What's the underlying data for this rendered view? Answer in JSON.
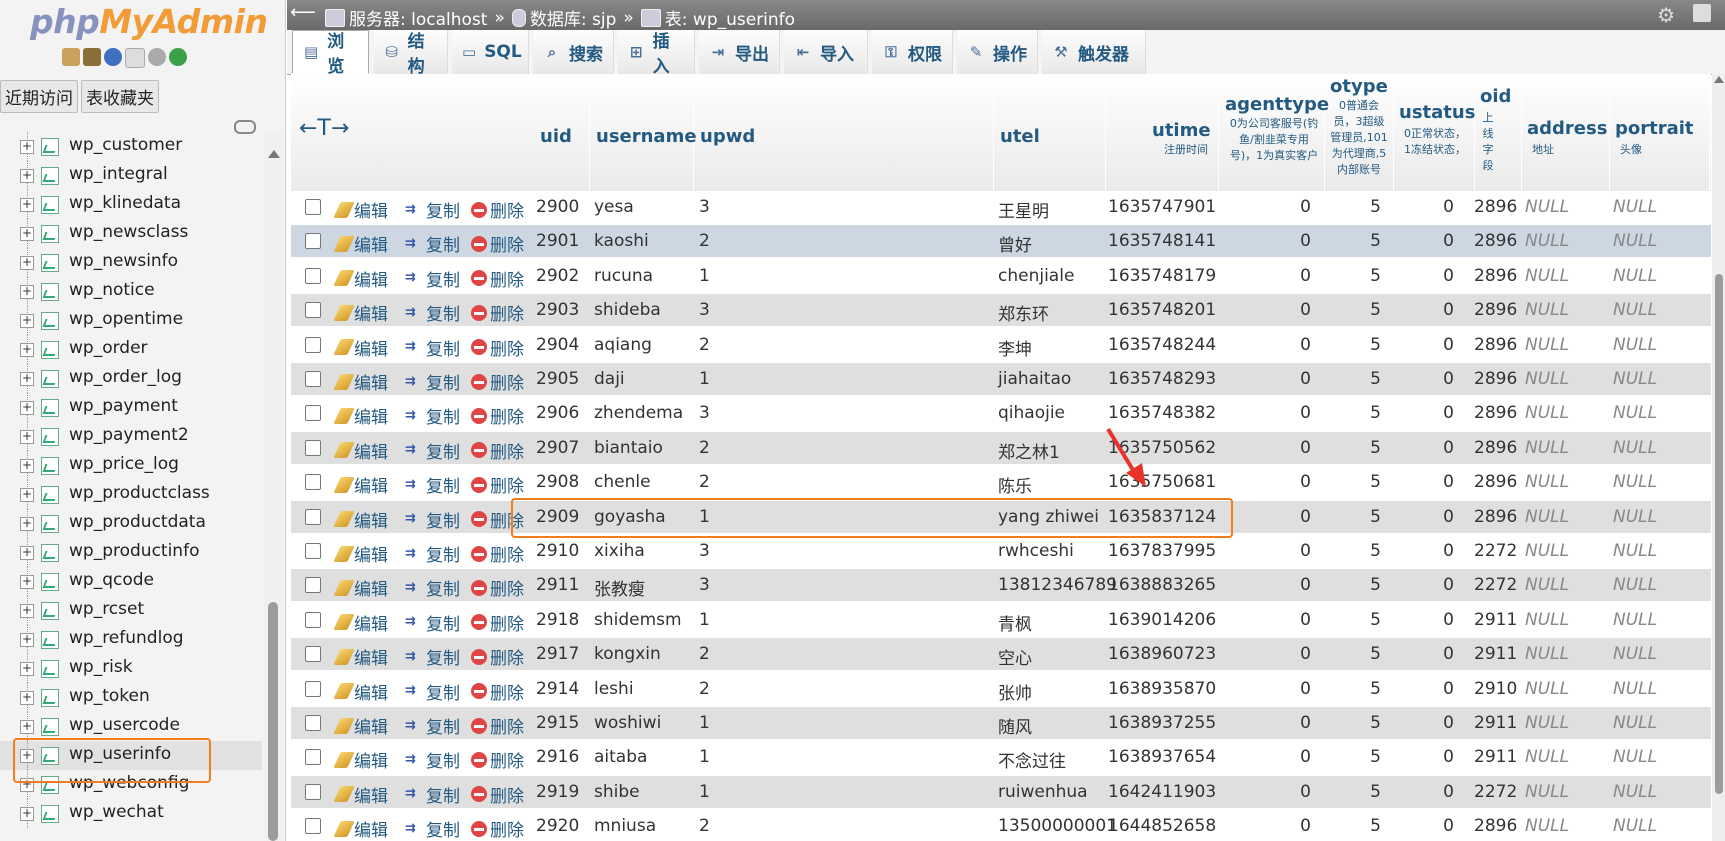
{
  "brand": {
    "php": "php",
    "myadmin": "MyAdmin"
  },
  "nav": {
    "tabs": [
      "近期访问",
      "表收藏夹"
    ],
    "tables": [
      "wp_customer",
      "wp_integral",
      "wp_klinedata",
      "wp_newsclass",
      "wp_newsinfo",
      "wp_notice",
      "wp_opentime",
      "wp_order",
      "wp_order_log",
      "wp_payment",
      "wp_payment2",
      "wp_price_log",
      "wp_productclass",
      "wp_productdata",
      "wp_productinfo",
      "wp_qcode",
      "wp_rcset",
      "wp_refundlog",
      "wp_risk",
      "wp_token",
      "wp_usercode",
      "wp_userinfo",
      "wp_webconfig",
      "wp_wechat"
    ],
    "selected": "wp_userinfo"
  },
  "breadcrumb": {
    "server": "服务器: localhost",
    "database": "数据库: sjp",
    "table": "表: wp_userinfo",
    "separator": "»"
  },
  "tabs": [
    {
      "label": "浏览",
      "icon": "browse-icon"
    },
    {
      "label": "结构",
      "icon": "structure-icon"
    },
    {
      "label": "SQL",
      "icon": "sql-icon"
    },
    {
      "label": "搜索",
      "icon": "search-icon"
    },
    {
      "label": "插入",
      "icon": "insert-icon"
    },
    {
      "label": "导出",
      "icon": "export-icon"
    },
    {
      "label": "导入",
      "icon": "import-icon"
    },
    {
      "label": "权限",
      "icon": "privileges-icon"
    },
    {
      "label": "操作",
      "icon": "operations-icon"
    },
    {
      "label": "触发器",
      "icon": "triggers-icon"
    }
  ],
  "table": {
    "arrows": "←T→",
    "actions": {
      "edit": "编辑",
      "copy": "复制",
      "delete": "删除"
    },
    "columns": [
      {
        "name": "uid",
        "comment": ""
      },
      {
        "name": "username",
        "comment": ""
      },
      {
        "name": "upwd",
        "comment": ""
      },
      {
        "name": "utel",
        "comment": ""
      },
      {
        "name": "utime",
        "comment": "注册时间"
      },
      {
        "name": "agenttype",
        "comment": "0为公司客服号(钓鱼/割韭菜专用号)，1为真实客户"
      },
      {
        "name": "otype",
        "comment": "0普通会员，3超级管理员,101为代理商,5内部账号"
      },
      {
        "name": "ustatus",
        "comment": "0正常状态，1冻结状态，"
      },
      {
        "name": "oid",
        "comment": "上线字段"
      },
      {
        "name": "address",
        "comment": "地址"
      },
      {
        "name": "portrait",
        "comment": "头像"
      }
    ],
    "rows": [
      [
        "2900",
        "yesa",
        "3",
        "王星明",
        "1635747901",
        "0",
        "5",
        "0",
        "2896",
        "NULL",
        "NULL"
      ],
      [
        "2901",
        "kaoshi",
        "2",
        "曾好",
        "1635748141",
        "0",
        "5",
        "0",
        "2896",
        "NULL",
        "NULL"
      ],
      [
        "2902",
        "rucuna",
        "1",
        "chenjiale",
        "1635748179",
        "0",
        "5",
        "0",
        "2896",
        "NULL",
        "NULL"
      ],
      [
        "2903",
        "shideba",
        "3",
        "郑东环",
        "1635748201",
        "0",
        "5",
        "0",
        "2896",
        "NULL",
        "NULL"
      ],
      [
        "2904",
        "aqiang",
        "2",
        "李坤",
        "1635748244",
        "0",
        "5",
        "0",
        "2896",
        "NULL",
        "NULL"
      ],
      [
        "2905",
        "daji",
        "1",
        "jiahaitao",
        "1635748293",
        "0",
        "5",
        "0",
        "2896",
        "NULL",
        "NULL"
      ],
      [
        "2906",
        "zhendema",
        "3",
        "qihaojie",
        "1635748382",
        "0",
        "5",
        "0",
        "2896",
        "NULL",
        "NULL"
      ],
      [
        "2907",
        "biantaio",
        "2",
        "郑之林1",
        "1635750562",
        "0",
        "5",
        "0",
        "2896",
        "NULL",
        "NULL"
      ],
      [
        "2908",
        "chenle",
        "2",
        "陈乐",
        "1635750681",
        "0",
        "5",
        "0",
        "2896",
        "NULL",
        "NULL"
      ],
      [
        "2909",
        "goyasha",
        "1",
        "yang zhiwei",
        "1635837124",
        "0",
        "5",
        "0",
        "2896",
        "NULL",
        "NULL"
      ],
      [
        "2910",
        "xixiha",
        "3",
        "rwhceshi",
        "1637837995",
        "0",
        "5",
        "0",
        "2272",
        "NULL",
        "NULL"
      ],
      [
        "2911",
        "张教瘦",
        "3",
        "13812346789",
        "1638883265",
        "0",
        "5",
        "0",
        "2272",
        "NULL",
        "NULL"
      ],
      [
        "2918",
        "shidemsm",
        "1",
        "青枫",
        "1639014206",
        "0",
        "5",
        "0",
        "2911",
        "NULL",
        "NULL"
      ],
      [
        "2917",
        "kongxin",
        "2",
        "空心",
        "1638960723",
        "0",
        "5",
        "0",
        "2911",
        "NULL",
        "NULL"
      ],
      [
        "2914",
        "leshi",
        "2",
        "张帅",
        "1638935870",
        "0",
        "5",
        "0",
        "2910",
        "NULL",
        "NULL"
      ],
      [
        "2915",
        "woshiwi",
        "1",
        "随风",
        "1638937255",
        "0",
        "5",
        "0",
        "2911",
        "NULL",
        "NULL"
      ],
      [
        "2916",
        "aitaba",
        "1",
        "不念过往",
        "1638937654",
        "0",
        "5",
        "0",
        "2911",
        "NULL",
        "NULL"
      ],
      [
        "2919",
        "shibe",
        "1",
        "ruiwenhua",
        "1642411903",
        "0",
        "5",
        "0",
        "2272",
        "NULL",
        "NULL"
      ],
      [
        "2920",
        "mniusa",
        "2",
        "13500000001",
        "1644852658",
        "0",
        "5",
        "0",
        "2896",
        "NULL",
        "NULL"
      ]
    ],
    "highlighted_uid": "2909"
  },
  "colors": {
    "link": "#235a81",
    "accent": "#f07d1e",
    "arrow": "#e8322b",
    "row_alt": "#dfdfdf",
    "row_hover": "#ccd7e2"
  }
}
